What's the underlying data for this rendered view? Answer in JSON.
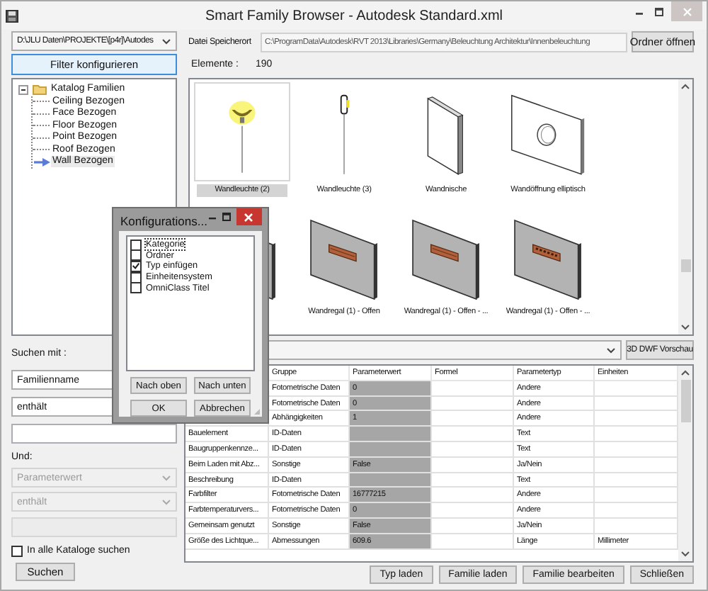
{
  "window": {
    "title": "Smart Family Browser - Autodesk Standard.xml"
  },
  "catalog_path": {
    "value": "D:\\JLU Daten\\PROJEKTE\\[p4r]\\Autodes"
  },
  "filter_button": "Filter konfigurieren",
  "tree": {
    "label": "Katalog Familien",
    "expanded": true,
    "children": [
      {
        "label": "Ceiling Bezogen",
        "selected": false
      },
      {
        "label": "Face Bezogen",
        "selected": false
      },
      {
        "label": "Floor Bezogen",
        "selected": false
      },
      {
        "label": "Point Bezogen",
        "selected": false
      },
      {
        "label": "Roof Bezogen",
        "selected": false
      },
      {
        "label": "Wall Bezogen",
        "selected": true
      }
    ]
  },
  "location": {
    "label": "Datei Speicherort",
    "value": "C:\\ProgramData\\Autodesk\\RVT 2013\\Libraries\\Germany\\Beleuchtung Architektur\\Innenbeleuchtung",
    "button": "Ordner öffnen"
  },
  "elements": {
    "label": "Elemente :",
    "count": "190"
  },
  "families": [
    {
      "label": "Wandleuchte (2)",
      "kind": "lamp-glow",
      "selected": true
    },
    {
      "label": "Wandleuchte (3)",
      "kind": "lamp-stick",
      "selected": false
    },
    {
      "label": "Wandnische",
      "kind": "niche",
      "selected": false
    },
    {
      "label": "Wandöffnung elliptisch",
      "kind": "opening",
      "selected": false
    },
    {
      "kind": "shelf",
      "selected": false
    },
    {
      "label": "Wandregal (1) - Offen",
      "kind": "shelf",
      "selected": false
    },
    {
      "label": "Wandregal (1) - Offen - ...",
      "kind": "shelf",
      "selected": false
    },
    {
      "label": "Wandregal (1) - Offen - ...",
      "kind": "shelf-dots",
      "selected": false
    }
  ],
  "preview_button": "3D DWF Vorschau",
  "search": {
    "label": "Suchen mit :",
    "field": {
      "value": "Familienname",
      "disabled": false
    },
    "condition": {
      "value": "enthält",
      "disabled": false
    },
    "and_label": "Und:",
    "field2": {
      "value": "Parameterwert",
      "disabled": true
    },
    "condition2": {
      "value": "enthält",
      "disabled": true
    },
    "value2": {
      "disabled": true
    },
    "all_catalogs": {
      "label": "In alle Kataloge suchen",
      "checked": false
    },
    "button": "Suchen"
  },
  "parameters": {
    "columns": [
      "Gruppe",
      "Parameterwert",
      "Formel",
      "Parametertyp",
      "Einheiten"
    ],
    "rows": [
      {
        "group": "Fotometrische Daten",
        "value": "0",
        "type": "Andere"
      },
      {
        "group": "Fotometrische Daten",
        "value": "0",
        "type": "Andere"
      },
      {
        "group": "Abhängigkeiten",
        "value": "1",
        "type": "Andere"
      },
      {
        "name": "Bauelement",
        "group": "ID-Daten",
        "type": "Text"
      },
      {
        "name": "Baugruppenkennze...",
        "group": "ID-Daten",
        "type": "Text"
      },
      {
        "name": "Beim Laden mit Abz...",
        "group": "Sonstige",
        "value": "False",
        "type": "Ja/Nein"
      },
      {
        "name": "Beschreibung",
        "group": "ID-Daten",
        "type": "Text"
      },
      {
        "name": "Farbfilter",
        "group": "Fotometrische Daten",
        "value": "16777215",
        "type": "Andere"
      },
      {
        "name": "Farbtemperaturvers...",
        "group": "Fotometrische Daten",
        "value": "0",
        "type": "Andere"
      },
      {
        "name": "Gemeinsam genutzt",
        "group": "Sonstige",
        "value": "False",
        "type": "Ja/Nein"
      },
      {
        "name": "Größe des Lichtque...",
        "group": "Abmessungen",
        "value": "609.6",
        "type": "Länge",
        "units": "Millimeter"
      }
    ]
  },
  "actions": [
    "Typ laden",
    "Familie laden",
    "Familie bearbeiten",
    "Schließen"
  ],
  "dialog": {
    "title": "Konfigurations...",
    "options": [
      {
        "label": "Kategorie",
        "checked": false,
        "focused": true
      },
      {
        "label": "Ordner",
        "checked": false,
        "focused": false
      },
      {
        "label": "Typ einfügen",
        "checked": true,
        "focused": false
      },
      {
        "label": "Einheitensystem",
        "checked": false,
        "focused": false
      },
      {
        "label": "OmniClass Titel",
        "checked": false,
        "focused": false
      }
    ],
    "buttons": [
      "Nach oben",
      "Nach unten",
      "OK",
      "Abbrechen"
    ]
  }
}
